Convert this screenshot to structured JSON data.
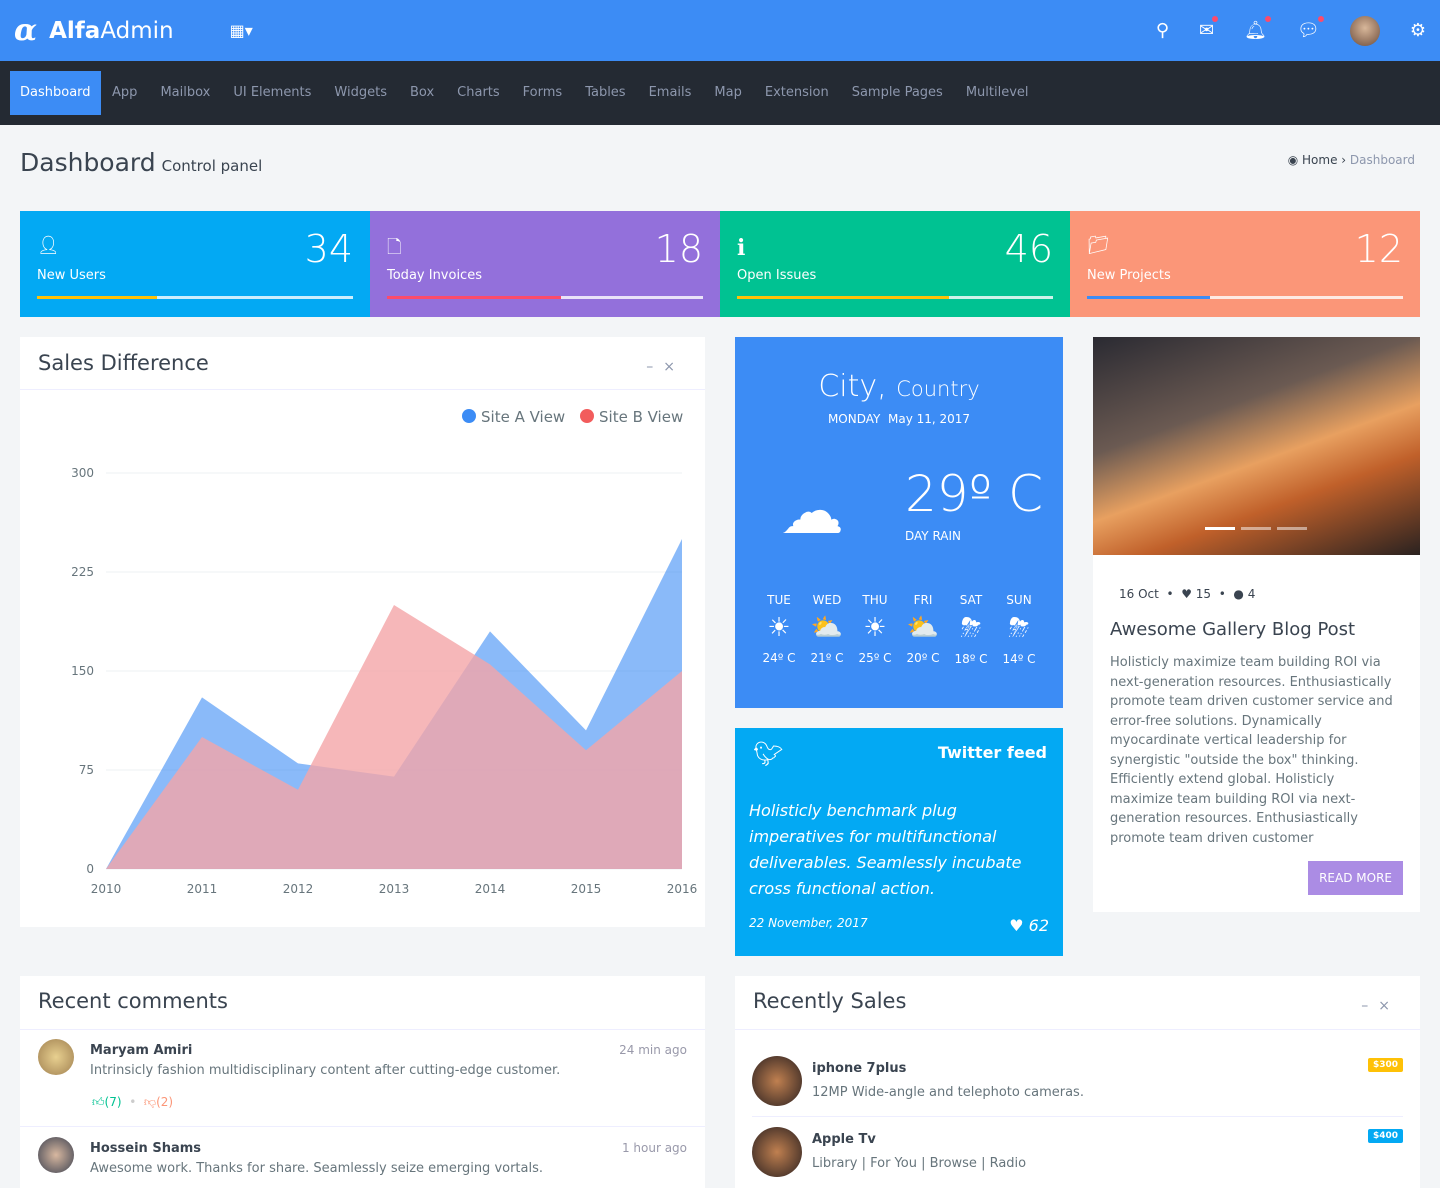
{
  "brand": {
    "bold": "Alfa",
    "light": "Admin"
  },
  "topbar": {
    "icons": [
      "search-icon",
      "mail-icon",
      "bell-icon",
      "chat-icon",
      "avatar",
      "gear-icon"
    ]
  },
  "nav": [
    "Dashboard",
    "App",
    "Mailbox",
    "UI Elements",
    "Widgets",
    "Box",
    "Charts",
    "Forms",
    "Tables",
    "Emails",
    "Map",
    "Extension",
    "Sample Pages",
    "Multilevel"
  ],
  "page": {
    "title": "Dashboard",
    "subtitle": "Control panel",
    "breadcrumb": [
      "Home",
      "Dashboard"
    ]
  },
  "stats": [
    {
      "label": "New Users",
      "value": "34",
      "color": "#03a9f3",
      "progress": 0.38,
      "bar": "#fec107"
    },
    {
      "label": "Today Invoices",
      "value": "18",
      "color": "#9370db",
      "progress": 0.55,
      "bar": "#fc4b6c"
    },
    {
      "label": "Open Issues",
      "value": "46",
      "color": "#00c292",
      "progress": 0.67,
      "bar": "#fec107"
    },
    {
      "label": "New Projects",
      "value": "12",
      "color": "#fb9678",
      "progress": 0.39,
      "bar": "#3c8cf5"
    }
  ],
  "sales": {
    "title": "Sales Difference"
  },
  "chart_data": {
    "type": "area",
    "categories": [
      "2010",
      "2011",
      "2012",
      "2013",
      "2014",
      "2015",
      "2016"
    ],
    "series": [
      {
        "name": "Site A View",
        "color": "#3c8cf5",
        "values": [
          0,
          130,
          80,
          70,
          180,
          105,
          250
        ]
      },
      {
        "name": "Site B View",
        "color": "#f4a5a8",
        "values": [
          0,
          100,
          60,
          200,
          155,
          90,
          150
        ]
      }
    ],
    "yticks": [
      0,
      75,
      150,
      225,
      300
    ],
    "ylim": [
      0,
      300
    ],
    "legend": "top-right",
    "grid": true
  },
  "weather": {
    "city": "City,",
    "country": "Country",
    "day": "MONDAY",
    "date": "May 11, 2017",
    "temp": "29º C",
    "cond": "DAY RAIN",
    "forecast": [
      {
        "d": "TUE",
        "t": "24º C",
        "i": "☀"
      },
      {
        "d": "WED",
        "t": "21º C",
        "i": "⛅"
      },
      {
        "d": "THU",
        "t": "25º C",
        "i": "☀"
      },
      {
        "d": "FRI",
        "t": "20º C",
        "i": "⛅"
      },
      {
        "d": "SAT",
        "t": "18º C",
        "i": "⛈"
      },
      {
        "d": "SUN",
        "t": "14º C",
        "i": "⛈"
      }
    ]
  },
  "twitter": {
    "title": "Twitter feed",
    "text": "Holisticly benchmark plug imperatives for multifunctional deliverables. Seamlessly incubate cross functional action.",
    "date": "22 November, 2017",
    "likes": "62"
  },
  "blog": {
    "date": "16 Oct",
    "likes": "15",
    "comments": "4",
    "title": "Awesome Gallery Blog Post",
    "text": "Holisticly maximize team building ROI via next-generation resources. Enthusiastically promote team driven customer service and error-free solutions. Dynamically myocardinate vertical leadership for synergistic \"outside the box\" thinking. Efficiently extend global. Holisticly maximize team building ROI via next-generation resources. Enthusiastically promote team driven customer",
    "button": "READ MORE"
  },
  "comments": {
    "title": "Recent comments",
    "items": [
      {
        "name": "Maryam Amiri",
        "text": "Intrinsicly fashion multidisciplinary content after cutting-edge customer.",
        "time": "24 min ago",
        "up": "(7)",
        "down": "(2)"
      },
      {
        "name": "Hossein Shams",
        "text": "Awesome work. Thanks for share. Seamlessly seize emerging vortals.",
        "time": "1 hour ago"
      }
    ]
  },
  "sales_list": {
    "title": "Recently Sales",
    "items": [
      {
        "name": "iphone 7plus",
        "desc": "12MP Wide-angle and telephoto cameras.",
        "price": "$300",
        "color": "#fec107"
      },
      {
        "name": "Apple Tv",
        "desc": "Library | For You | Browse | Radio",
        "price": "$400",
        "color": "#03a9f3"
      }
    ]
  }
}
